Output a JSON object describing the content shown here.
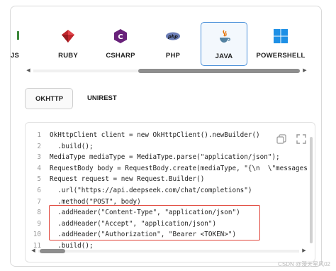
{
  "languages": [
    {
      "label": "JS",
      "icon": "nodejs-icon"
    },
    {
      "label": "RUBY",
      "icon": "ruby-icon"
    },
    {
      "label": "CSHARP",
      "icon": "csharp-icon"
    },
    {
      "label": "PHP",
      "icon": "php-icon"
    },
    {
      "label": "JAVA",
      "icon": "java-icon",
      "active": true
    },
    {
      "label": "POWERSHELL",
      "icon": "windows-icon"
    }
  ],
  "libraries": [
    {
      "label": "OKHTTP",
      "active": true
    },
    {
      "label": "UNIREST"
    }
  ],
  "code": {
    "lines": [
      {
        "n": "1",
        "text": "OkHttpClient client = new OkHttpClient().newBuilder()"
      },
      {
        "n": "2",
        "text": "  .build();"
      },
      {
        "n": "3",
        "text": "MediaType mediaType = MediaType.parse(\"application/json\");"
      },
      {
        "n": "4",
        "text": "RequestBody body = RequestBody.create(mediaType, \"{\\n  \\\"messages"
      },
      {
        "n": "5",
        "text": "Request request = new Request.Builder()"
      },
      {
        "n": "6",
        "text": "  .url(\"https://api.deepseek.com/chat/completions\")"
      },
      {
        "n": "7",
        "text": "  .method(\"POST\", body)"
      },
      {
        "n": "8",
        "text": "  .addHeader(\"Content-Type\", \"application/json\")"
      },
      {
        "n": "9",
        "text": "  .addHeader(\"Accept\", \"application/json\")"
      },
      {
        "n": "10",
        "text": "  .addHeader(\"Authorization\", \"Bearer <TOKEN>\")"
      },
      {
        "n": "11",
        "text": "  .build();"
      }
    ]
  },
  "watermark": "CSDN @漫天星风02",
  "colors": {
    "active_border": "#4a90d9",
    "highlight_border": "#e0463b",
    "ruby": "#c0262c",
    "csharp": "#68217a",
    "php": "#6c7eb7",
    "java": "#e76f00",
    "windows": "#1e90e6",
    "node": "#3c873a"
  }
}
